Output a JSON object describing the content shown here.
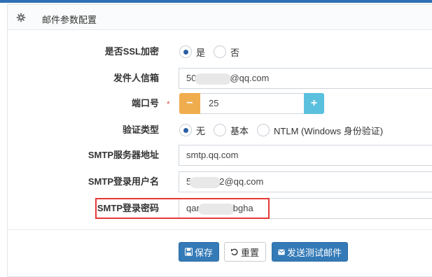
{
  "header": {
    "title": "邮件参数配置",
    "icon": "gear-icon"
  },
  "form": {
    "ssl": {
      "label": "是否SSL加密",
      "options": [
        "是",
        "否"
      ],
      "selected": "是"
    },
    "sender": {
      "label": "发件人信箱",
      "value_prefix": "50",
      "value_suffix": "@qq.com"
    },
    "port": {
      "label": "端口号",
      "required_mark": "*",
      "value": "25",
      "minus": "−",
      "plus": "+"
    },
    "auth": {
      "label": "验证类型",
      "options": [
        "无",
        "基本",
        "NTLM (Windows 身份验证)"
      ],
      "selected": "无"
    },
    "smtp_server": {
      "label": "SMTP服务器地址",
      "value": "smtp.qq.com"
    },
    "smtp_user": {
      "label": "SMTP登录用户名",
      "value_prefix": "5",
      "value_suffix": "2@qq.com"
    },
    "smtp_password": {
      "label": "SMTP登录密码",
      "value_prefix": "qar",
      "value_suffix": "bgha"
    }
  },
  "actions": {
    "save": "保存",
    "reset": "重置",
    "test": "发送测试邮件"
  },
  "colors": {
    "primary": "#337ab7",
    "warning": "#f0ad4e",
    "info": "#5bc0de",
    "highlight": "#e53935"
  }
}
